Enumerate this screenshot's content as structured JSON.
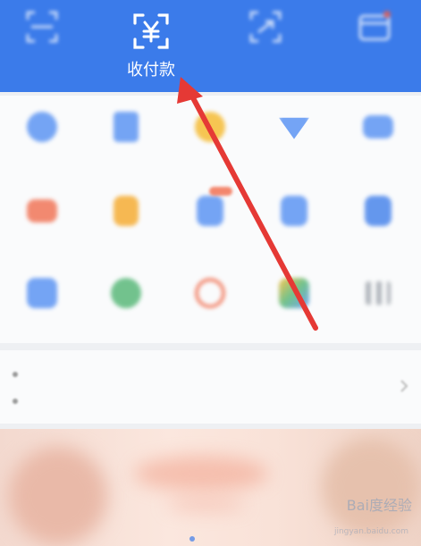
{
  "top_bar": {
    "items": [
      {
        "label": "",
        "icon": "scan-icon"
      },
      {
        "label": "收付款",
        "icon": "yuan-receipt-icon"
      },
      {
        "label": "",
        "icon": "travel-icon"
      },
      {
        "label": "",
        "icon": "card-icon"
      }
    ]
  },
  "colors": {
    "top_bar_bg": "#3b7bea",
    "arrow": "#e53935"
  },
  "watermark": {
    "logo": "Bai度经验",
    "sub": "jingyan.baidu.com"
  }
}
